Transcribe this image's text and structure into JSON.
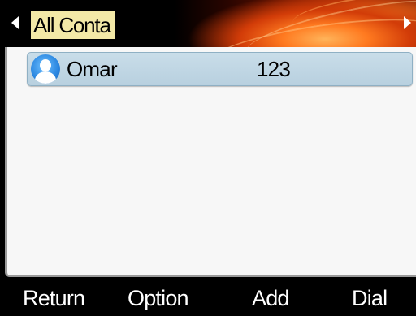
{
  "header": {
    "title": "All Conta",
    "left_icon": "arrow-left-icon",
    "right_icon": "arrow-right-icon"
  },
  "contacts": [
    {
      "name": "Omar",
      "number": "123",
      "icon": "user-avatar-icon",
      "selected": true
    }
  ],
  "softkeys": {
    "return_label": "Return",
    "option_label": "Option",
    "add_label": "Add",
    "dial_label": "Dial"
  },
  "colors": {
    "title_highlight": "#f3e9a7",
    "row_selected": "#c9dde9",
    "header_accent": "#d23c08",
    "list_background": "#f7f7f7"
  }
}
